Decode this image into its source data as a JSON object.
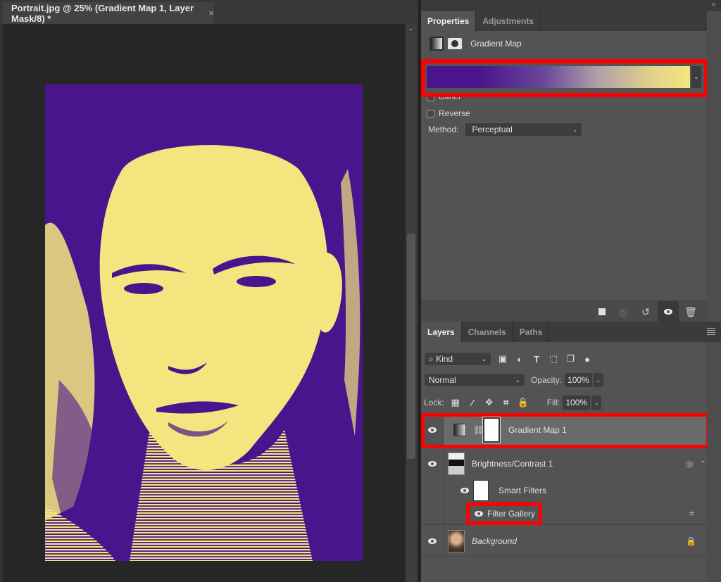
{
  "document": {
    "tab_title": "Portrait.jpg @ 25% (Gradient Map 1, Layer Mask/8) *",
    "close_icon": "×",
    "scroll_up_icon": "⌃",
    "artwork_colors": {
      "shadow": "#4a148c",
      "highlight": "#f4e67e"
    }
  },
  "panels": {
    "collapse_icon": "»",
    "properties": {
      "tabs": [
        {
          "label": "Properties",
          "active": true
        },
        {
          "label": "Adjustments",
          "active": false
        }
      ],
      "header_title": "Gradient Map",
      "gradient": {
        "stops": [
          "#4a148c",
          "#f4e67e"
        ],
        "dropdown_icon": "⌄"
      },
      "dither_label": "Dither",
      "dither_checked": false,
      "reverse_label": "Reverse",
      "reverse_checked": false,
      "method_label": "Method:",
      "method_value": "Perceptual",
      "footer_icons": [
        "clip-to-layer",
        "view-previous-state",
        "reset-to-defaults",
        "toggle-visibility",
        "delete-adjustment"
      ]
    },
    "layers": {
      "tabs": [
        {
          "label": "Layers",
          "active": true
        },
        {
          "label": "Channels",
          "active": false
        },
        {
          "label": "Paths",
          "active": false
        }
      ],
      "filter_kind": "Kind",
      "blend_mode": "Normal",
      "opacity_label": "Opacity:",
      "opacity_value": "100%",
      "lock_label": "Lock:",
      "fill_label": "Fill:",
      "fill_value": "100%",
      "items": [
        {
          "name": "Gradient Map 1",
          "visible": true,
          "selected": true
        },
        {
          "name": "Brightness/Contrast 1",
          "visible": true,
          "selected": false
        },
        {
          "name": "Smart Filters",
          "visible": true,
          "selected": false
        },
        {
          "name": "Filter Gallery",
          "visible": true,
          "selected": false
        },
        {
          "name": "Background",
          "visible": true,
          "selected": false
        }
      ]
    }
  }
}
